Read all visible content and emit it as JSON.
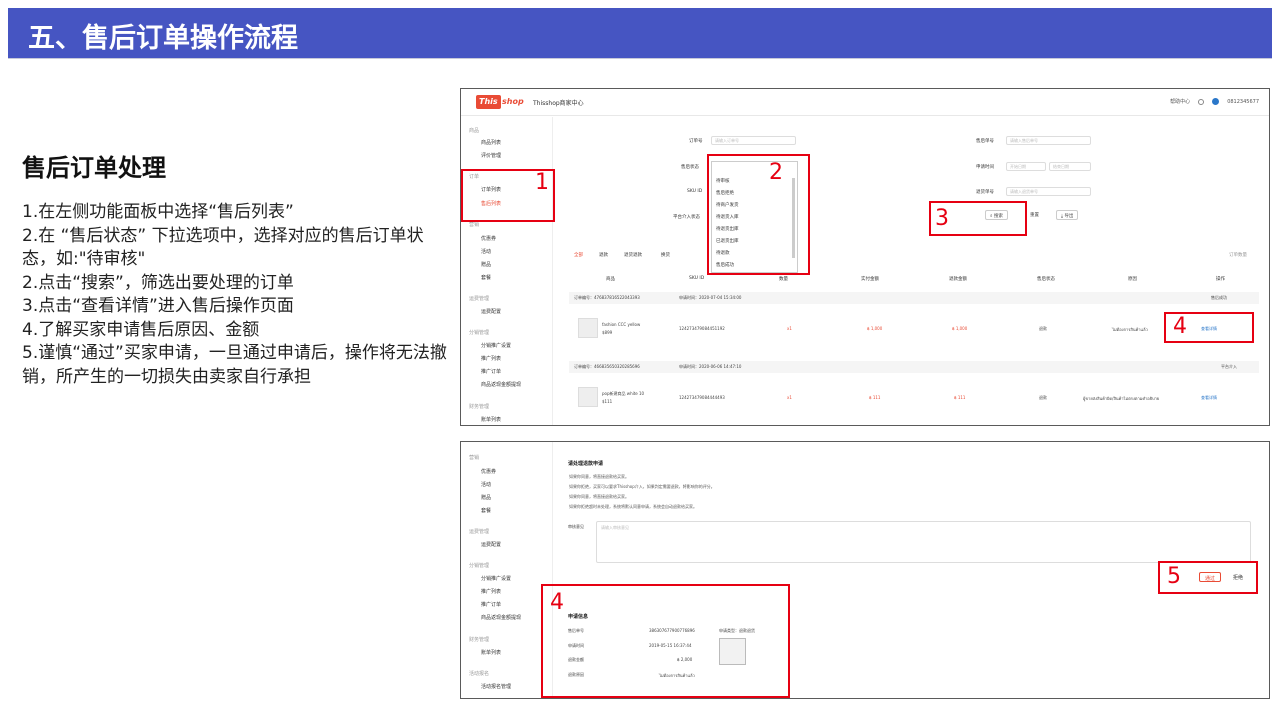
{
  "slide": {
    "title": "五、售后订单操作流程",
    "section_title": "售后订单处理",
    "steps": [
      "1.在左侧功能面板中选择“售后列表”",
      "2.在 “售后状态” 下拉选项中，选择对应的售后订单状态，如:\"待审核\"",
      "2.点击“搜索”，筛选出要处理的订单",
      "3.点击“查看详情”进入售后操作页面",
      "4.了解买家申请售后原因、金额",
      "5.谨慎“通过”买家申请，一旦通过申请后，操作将无法撤销，所产生的一切损失由卖家自行承担"
    ],
    "brand_color": "#4655c2",
    "callout_color": "#e60012"
  },
  "screenshot1": {
    "logo_left": "This",
    "logo_right": "shop",
    "app_title": "Thisshop商家中心",
    "help": "帮助中心",
    "account": "0812345677",
    "sidebar": {
      "group_product": "商品",
      "product_list": "商品列表",
      "review_mgmt": "评价管理",
      "group_order": "订单",
      "order_list": "订单列表",
      "aftersale_list": "售后列表",
      "group_marketing": "营销",
      "coupons": "优惠券",
      "activities": "活动",
      "gifts": "赠品",
      "bundles": "套餐",
      "group_logistics": "运费管理",
      "shipping_config": "运费配置",
      "group_distribution": "分销管理",
      "distribution_settings": "分销推广设置",
      "promo_list": "推广列表",
      "promo_orders": "推广订单",
      "withdraw": "商品返现金额提现",
      "group_finance": "财务管理",
      "account_list": "账单列表"
    },
    "filters": {
      "order_no_label": "订单号",
      "order_no_placeholder": "请输入订单号",
      "aftersale_no_label": "售后单号",
      "aftersale_no_placeholder": "请输入售后单号",
      "status_label": "售后状态",
      "status_value": "待审核",
      "apply_time_label": "申请时间",
      "start_date": "开始日期",
      "end_date": "结束日期",
      "sku_label": "SKU ID",
      "return_no_label": "退货单号",
      "return_no_placeholder": "请输入退货单号",
      "platform_label": "平台介入状态",
      "search_btn": "搜索",
      "reset_btn": "重置",
      "export_btn": "导出"
    },
    "status_options": [
      "待审核",
      "售后拒绝",
      "待商户发货",
      "待退货入库",
      "待退货出库",
      "已退货出库",
      "待退款",
      "售后成功"
    ],
    "tabs": [
      "全部",
      "退款",
      "退货退款",
      "换货"
    ],
    "export_records": "订单数量",
    "columns": [
      "商品",
      "SKU ID",
      "数量",
      "实付金额",
      "退款金额",
      "售后状态",
      "原因",
      "操作"
    ],
    "orders": [
      {
        "order_no": "订单编号：476837816522043393",
        "apply_time": "申请时间：2020-07-04 15:34:00",
        "product": "fashion CCC yellow",
        "price": "$899",
        "sku": "124273479084451192",
        "qty": "x1",
        "paid": "฿ 1,000",
        "refund": "฿ 1,000",
        "status": "退款",
        "reason": "ไม่ต้องการสินค้าแล้ว",
        "action": "查看详情",
        "badge": "售后成功"
      },
      {
        "order_no": "订单编号：466835650320285696",
        "apply_time": "申请时间：2020-06-06 14:47:10",
        "product": "pop新建商品 white 10",
        "price": "$111",
        "sku": "124273479084444493",
        "qty": "x1",
        "paid": "฿ 111",
        "refund": "฿ 111",
        "status": "退款",
        "reason": "ผู้ขายส่งสินค้าผิด/สินค้าไม่ตรงตามคำอธิบาย",
        "action": "查看详情",
        "badge": "平台介入"
      }
    ],
    "callouts": [
      "1",
      "2",
      "3",
      "4"
    ]
  },
  "screenshot2": {
    "sidebar": {
      "group_marketing": "营销",
      "coupons": "优惠券",
      "activities": "活动",
      "gifts": "赠品",
      "bundles": "套餐",
      "group_logistics": "运费管理",
      "shipping_config": "运费配置",
      "group_distribution": "分销管理",
      "distribution_settings": "分销推广设置",
      "promo_list": "推广列表",
      "promo_orders": "推广订单",
      "withdraw": "商品返现金额提现",
      "group_finance": "财务管理",
      "account_list": "账单列表",
      "group_other": "活动报名",
      "activity_mgmt": "活动报名管理"
    },
    "heading": "请处理退款申请",
    "warnings": [
      "如果你同意，将直接退款给买家。",
      "如果你拒绝，买家可以要求Thisshop介入，如果判定需要退款，将影响你的评分。",
      "如果你同意，将直接退款给买家。",
      "如果你拒绝超时未处理，系统将默认同意申请，系统会自动退款给买家。"
    ],
    "remark_label": "审核意见",
    "remark_placeholder": "请输入审核意见",
    "approve_btn": "通过",
    "reject_btn": "拒绝",
    "info": {
      "title": "申请信息",
      "order_no_label": "售后单号",
      "order_no": "386307677900776896",
      "apply_time_label": "申请时间",
      "apply_time": "2019-05-15 16:37:44",
      "refund_label": "退款金额",
      "refund": "฿ 2,000",
      "reason_label": "退款原因",
      "reason": "ไม่ต้องการสินค้าแล้ว",
      "type_label": "申请类型：退款退货"
    },
    "callouts": [
      "5",
      "4"
    ]
  }
}
